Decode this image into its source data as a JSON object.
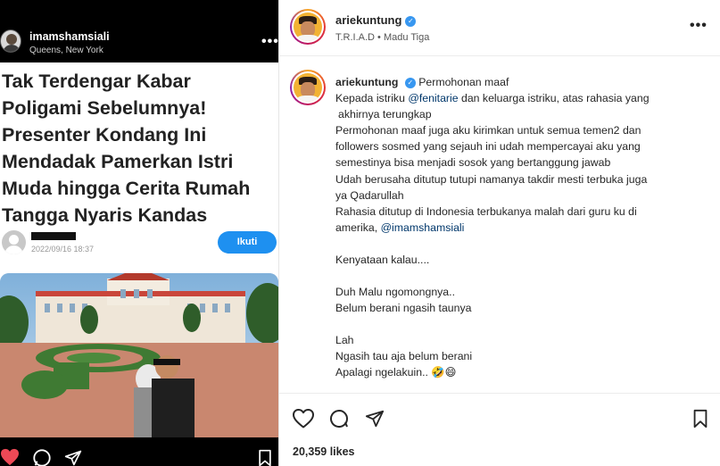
{
  "left_post": {
    "username": "imamshamsiali",
    "location": "Queens, New York",
    "headline_lines": [
      "Tak Terdengar Kabar",
      "Poligami Sebelumnya!",
      "Presenter Kondang Ini",
      "Mendadak Pamerkan Istri",
      "Muda hingga Cerita Rumah",
      "Tangga Nyaris Kandas"
    ],
    "article_date": "2022/09/16 18:37",
    "follow_label": "Ikuti"
  },
  "right_post": {
    "username": "ariekuntung",
    "subtitle": "T.R.I.A.D • Madu Tiga",
    "caption": {
      "username": "ariekuntung",
      "title": "Permohonan maaf",
      "line1_pre": "Kepada istriku ",
      "mention1": "@fenitarie",
      "line1_post": " dan keluarga istriku, atas rahasia yang",
      "line2": "akhirnya terungkap",
      "line3": "Permohonan maaf juga aku kirimkan untuk semua temen2 dan",
      "line4": "followers sosmed yang sejauh ini udah mempercayai aku yang",
      "line5": "semestinya bisa menjadi sosok yang bertanggung jawab",
      "line6": "Udah berusaha ditutup tutupi namanya takdir mesti terbuka juga",
      "line7": "ya Qadarullah",
      "line8": "Rahasia ditutup di Indonesia terbukanya malah dari guru ku di",
      "line9_pre": "amerika, ",
      "mention2": "@imamshamsiali",
      "line10": "Kenyataan kalau....",
      "line11": "Duh Malu ngomongnya..",
      "line12": "Belum berani ngasih taunya",
      "line13": "Lah",
      "line14": "Ngasih tau aja belum berani",
      "line15": "Apalagi ngelakuin..",
      "emojis": "🤣😄"
    },
    "likes": "20,359 likes"
  },
  "colors": {
    "follow_button": "#1e90f0",
    "verified": "#3897f0",
    "mention": "#00376b",
    "like_active": "#ed4956"
  },
  "icons": [
    "heart-icon",
    "comment-icon",
    "share-icon",
    "bookmark-icon",
    "more-icon",
    "verified-icon"
  ]
}
